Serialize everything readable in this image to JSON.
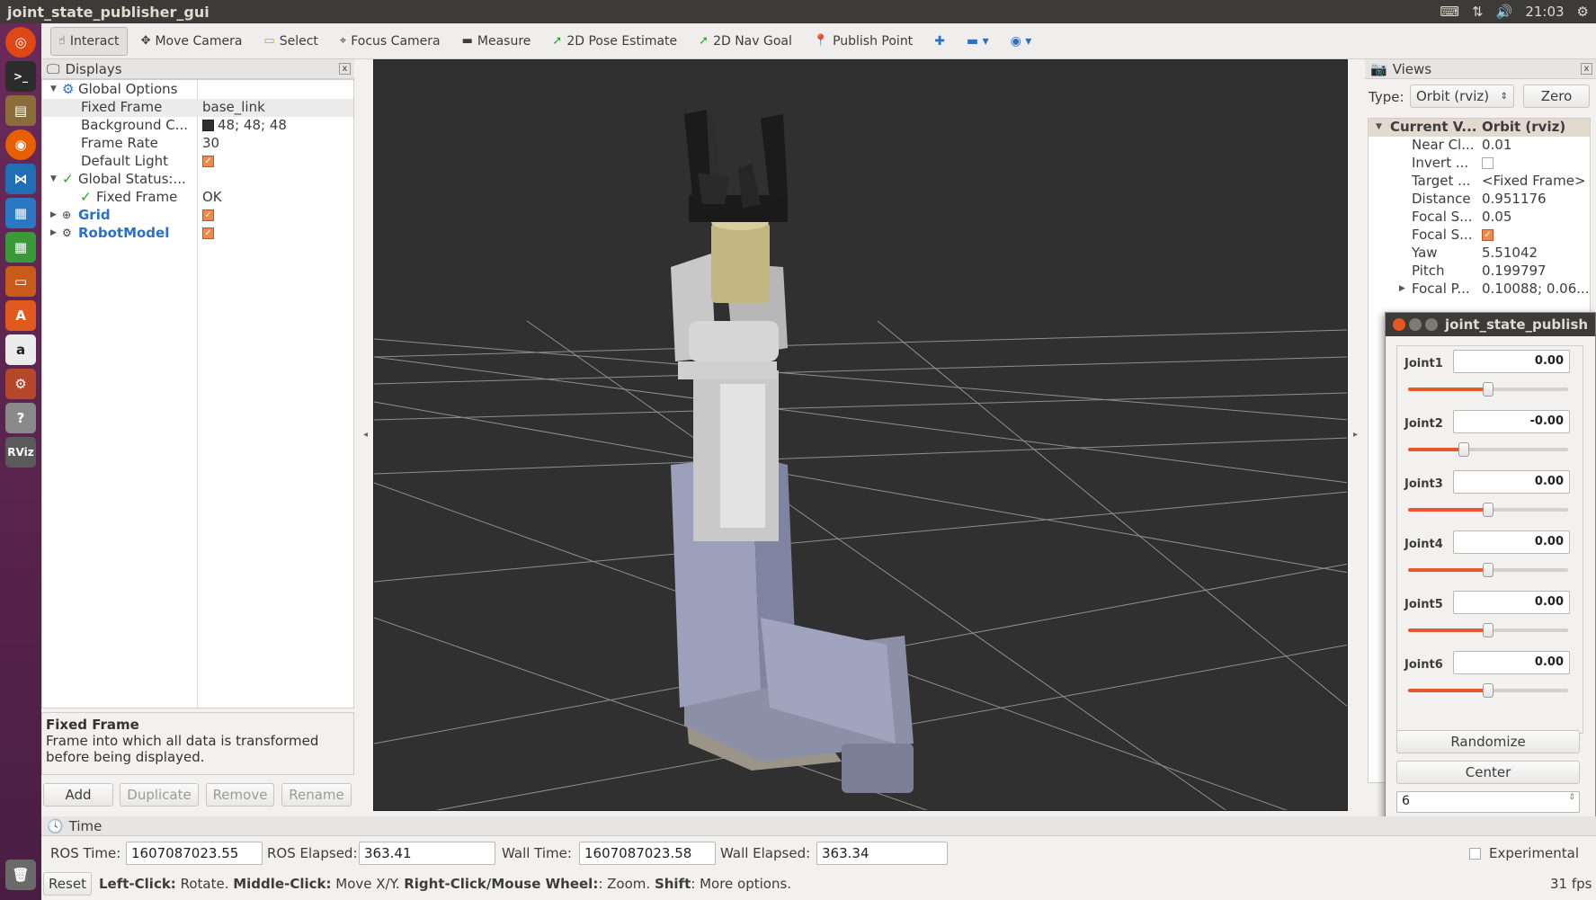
{
  "window": {
    "title": "joint_state_publisher_gui"
  },
  "tray": {
    "clock": "21:03",
    "keyboard": "keyboard-icon",
    "network": "network-icon",
    "volume": "volume-icon",
    "settings": "gear-icon"
  },
  "toolbar": {
    "tools": [
      {
        "label": "Interact",
        "icon": "hand-icon",
        "active": true
      },
      {
        "label": "Move Camera",
        "icon": "move-icon"
      },
      {
        "label": "Select",
        "icon": "select-icon"
      },
      {
        "label": "Focus Camera",
        "icon": "focus-icon"
      },
      {
        "label": "Measure",
        "icon": "ruler-icon"
      },
      {
        "label": "2D Pose Estimate",
        "icon": "pose-arrow-icon"
      },
      {
        "label": "2D Nav Goal",
        "icon": "nav-arrow-icon"
      },
      {
        "label": "Publish Point",
        "icon": "pin-icon"
      }
    ]
  },
  "displays": {
    "title": "Displays",
    "rows": [
      {
        "key": "Global Options"
      },
      {
        "key": "Fixed Frame",
        "value": "base_link"
      },
      {
        "key": "Background C...",
        "value": "48; 48; 48"
      },
      {
        "key": "Frame Rate",
        "value": "30"
      },
      {
        "key": "Default Light"
      },
      {
        "key": "Global Status:..."
      },
      {
        "key": "Fixed Frame",
        "value": "OK"
      },
      {
        "key": "Grid"
      },
      {
        "key": "RobotModel"
      }
    ],
    "description_title": "Fixed Frame",
    "description_text": "Frame into which all data is transformed before being displayed.",
    "buttons": {
      "add": "Add",
      "duplicate": "Duplicate",
      "remove": "Remove",
      "rename": "Rename"
    }
  },
  "views": {
    "title": "Views",
    "type_label": "Type:",
    "type_value": "Orbit (rviz)",
    "zero": "Zero",
    "header_key": "Current V...",
    "header_value": "Orbit (rviz)",
    "rows": [
      {
        "key": "Near Cl...",
        "value": "0.01"
      },
      {
        "key": "Invert ..."
      },
      {
        "key": "Target ...",
        "value": "<Fixed Frame>"
      },
      {
        "key": "Distance",
        "value": "0.951176"
      },
      {
        "key": "Focal S...",
        "value": "0.05"
      },
      {
        "key": "Focal S..."
      },
      {
        "key": "Yaw",
        "value": "5.51042"
      },
      {
        "key": "Pitch",
        "value": "0.199797"
      },
      {
        "key": "Focal P...",
        "value": "0.10088; 0.06..."
      }
    ]
  },
  "jsp": {
    "title": "joint_state_publish",
    "joints": [
      {
        "name": "Joint1",
        "value": "0.00",
        "position": 0.5
      },
      {
        "name": "Joint2",
        "value": "-0.00",
        "position": 0.35
      },
      {
        "name": "Joint3",
        "value": "0.00",
        "position": 0.5
      },
      {
        "name": "Joint4",
        "value": "0.00",
        "position": 0.5
      },
      {
        "name": "Joint5",
        "value": "0.00",
        "position": 0.5
      },
      {
        "name": "Joint6",
        "value": "0.00",
        "position": 0.5
      }
    ],
    "randomize": "Randomize",
    "center": "Center",
    "count": "6"
  },
  "time": {
    "title": "Time",
    "ros_time_label": "ROS Time:",
    "ros_time": "1607087023.55",
    "ros_elapsed_label": "ROS Elapsed:",
    "ros_elapsed": "363.41",
    "wall_time_label": "Wall Time:",
    "wall_time": "1607087023.58",
    "wall_elapsed_label": "Wall Elapsed:",
    "wall_elapsed": "363.34",
    "experimental": "Experimental",
    "reset": "Reset",
    "hint_left_bold": "Left-Click:",
    "hint_left": " Rotate. ",
    "hint_mid_bold": "Middle-Click:",
    "hint_mid": " Move X/Y. ",
    "hint_right_bold": "Right-Click/Mouse Wheel:",
    "hint_right": ": Zoom. ",
    "hint_shift_bold": "Shift",
    "hint_shift": ": More options.",
    "fps": "31 fps"
  }
}
